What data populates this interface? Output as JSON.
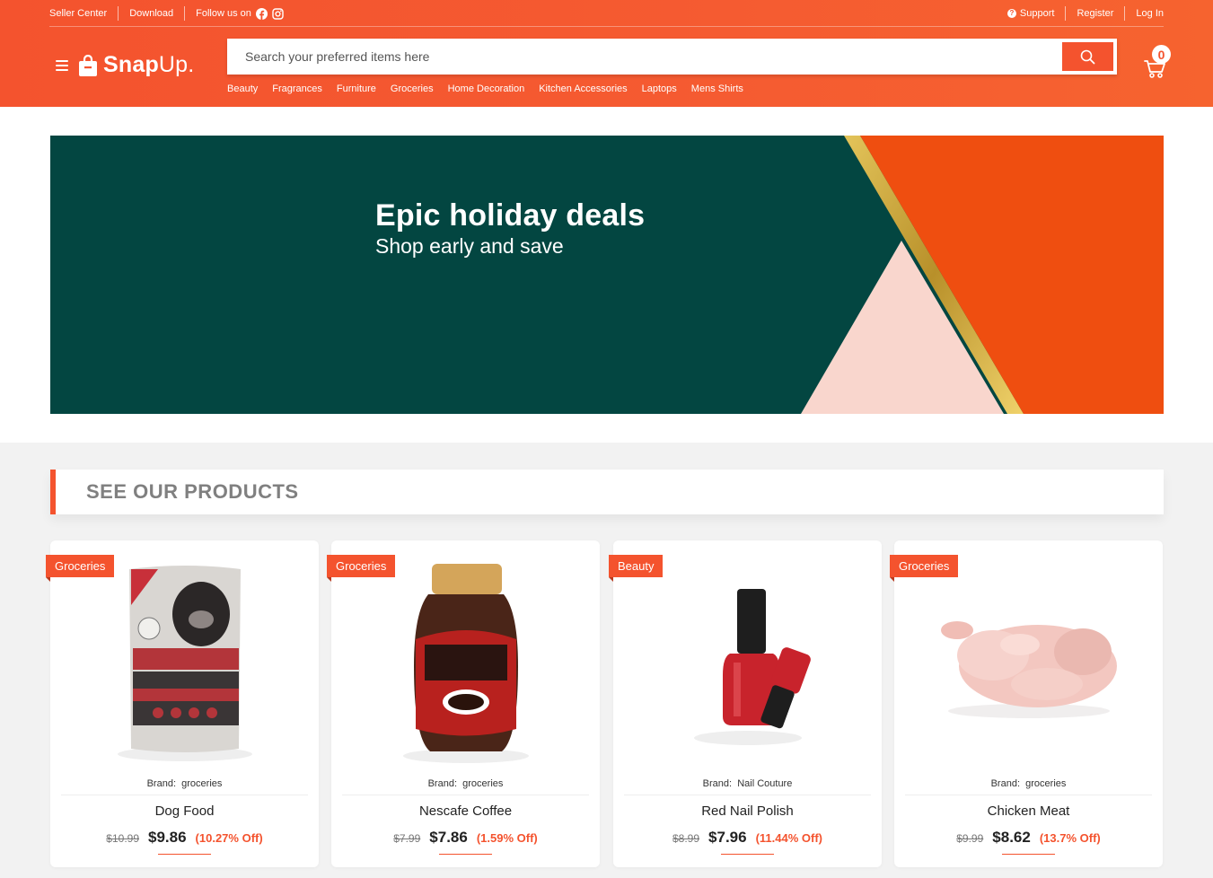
{
  "topbar": {
    "seller_center": "Seller Center",
    "download": "Download",
    "follow_us": "Follow us on",
    "support": "Support",
    "register": "Register",
    "login": "Log In"
  },
  "brand": {
    "name_bold": "Snap",
    "name_light": "Up."
  },
  "search": {
    "placeholder": "Search your preferred items here"
  },
  "categories": [
    "Beauty",
    "Fragrances",
    "Furniture",
    "Groceries",
    "Home Decoration",
    "Kitchen Accessories",
    "Laptops",
    "Mens Shirts"
  ],
  "cart": {
    "count": "0"
  },
  "banner": {
    "title": "Epic holiday deals",
    "subtitle": "Shop early and save"
  },
  "section": {
    "title": "SEE OUR PRODUCTS"
  },
  "products": [
    {
      "category": "Groceries",
      "brand_label": "Brand:",
      "brand": "groceries",
      "name": "Dog Food",
      "old_price": "$10.99",
      "price": "$9.86",
      "discount": "(10.27% Off)"
    },
    {
      "category": "Groceries",
      "brand_label": "Brand:",
      "brand": "groceries",
      "name": "Nescafe Coffee",
      "old_price": "$7.99",
      "price": "$7.86",
      "discount": "(1.59% Off)"
    },
    {
      "category": "Beauty",
      "brand_label": "Brand:",
      "brand": "Nail Couture",
      "name": "Red Nail Polish",
      "old_price": "$8.99",
      "price": "$7.96",
      "discount": "(11.44% Off)"
    },
    {
      "category": "Groceries",
      "brand_label": "Brand:",
      "brand": "groceries",
      "name": "Chicken Meat",
      "old_price": "$9.99",
      "price": "$8.62",
      "discount": "(13.7% Off)"
    }
  ],
  "colors": {
    "accent": "#f4532e",
    "banner_bg": "#034641",
    "gold": "#c9a43a"
  }
}
